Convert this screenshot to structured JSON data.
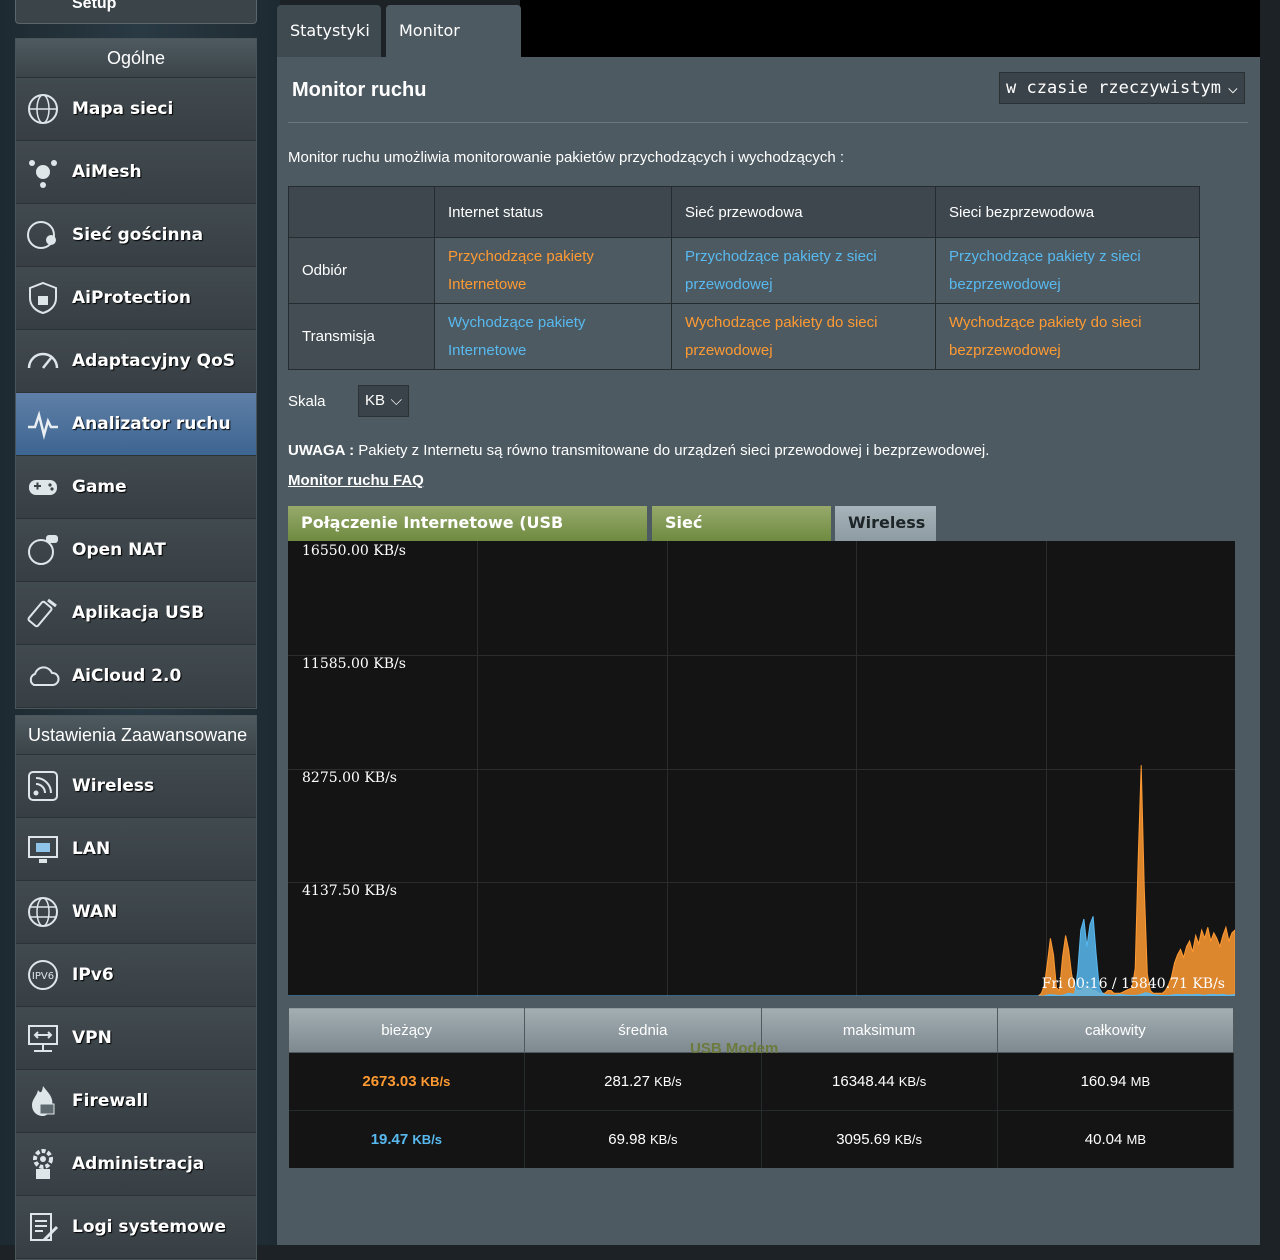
{
  "sidebar": {
    "top_stub_label": "Setup",
    "general": {
      "heading": "Ogólne",
      "items": [
        {
          "label": "Mapa sieci",
          "icon": "globe-network-icon"
        },
        {
          "label": "AiMesh",
          "icon": "aimesh-icon"
        },
        {
          "label": "Sieć gościnna",
          "icon": "guest-network-icon"
        },
        {
          "label": "AiProtection",
          "icon": "shield-lock-icon"
        },
        {
          "label": "Adaptacyjny QoS",
          "icon": "speedometer-icon"
        },
        {
          "label": "Analizator ruchu",
          "icon": "traffic-analyzer-icon"
        },
        {
          "label": "Game",
          "icon": "gamepad-icon"
        },
        {
          "label": "Open NAT",
          "icon": "open-nat-icon"
        },
        {
          "label": "Aplikacja USB",
          "icon": "usb-app-icon"
        },
        {
          "label": "AiCloud 2.0",
          "icon": "cloud-icon"
        }
      ]
    },
    "advanced": {
      "heading": "Ustawienia Zaawansowane",
      "items": [
        {
          "label": "Wireless",
          "icon": "wireless-icon"
        },
        {
          "label": "LAN",
          "icon": "lan-icon"
        },
        {
          "label": "WAN",
          "icon": "wan-globe-icon"
        },
        {
          "label": "IPv6",
          "icon": "ipv6-icon"
        },
        {
          "label": "VPN",
          "icon": "vpn-icon"
        },
        {
          "label": "Firewall",
          "icon": "firewall-icon"
        },
        {
          "label": "Administracja",
          "icon": "admin-gear-icon"
        },
        {
          "label": "Logi systemowe",
          "icon": "system-log-icon"
        }
      ]
    }
  },
  "tabs": {
    "stats": "Statystyki",
    "monitor": "Monitor ruchu"
  },
  "main": {
    "title": "Monitor ruchu",
    "mode_select": "w czasie rzeczywistym",
    "description": "Monitor ruchu umożliwia monitorowanie pakietów przychodzących i wychodzących :",
    "legend": {
      "headers": [
        "Internet status",
        "Sieć przewodowa",
        "Sieci bezprzewodowa"
      ],
      "rows": [
        {
          "label": "Odbiór",
          "cells": [
            "Przychodzące pakiety Internetowe",
            "Przychodzące pakiety z sieci przewodowej",
            "Przychodzące pakiety z sieci bezprzewodowej"
          ]
        },
        {
          "label": "Transmisja",
          "cells": [
            "Wychodzące pakiety Internetowe",
            "Wychodzące pakiety do sieci przewodowej",
            "Wychodzące pakiety do sieci bezprzewodowej"
          ]
        }
      ]
    },
    "scale_label": "Skala",
    "scale_value": "KB",
    "note_bold": "UWAGA :",
    "note_text": " Pakiety z Internetu są równo transmitowane do urządzeń sieci przewodowej i bezprzewodowej.",
    "faq_link": "Monitor ruchu FAQ",
    "graph_tabs": [
      "Połączenie Internetowe (USB Modem)",
      "Sieć przewodowa",
      "Wireless"
    ],
    "graph_overlay": "USB Modem",
    "colors": {
      "rx": "#ff9a32",
      "tx": "#58b9f0",
      "active_tab": "#7f9a4f"
    }
  },
  "chart_data": {
    "type": "area",
    "y_tick_labels": [
      "16550.00 KB/s",
      "11585.00 KB/s",
      "8275.00 KB/s",
      "4137.50 KB/s"
    ],
    "ylim": [
      0,
      16550
    ],
    "timestamp_label": "Fri 00:16 / 15840.71 KB/s",
    "series": [
      {
        "color": "#ff9a32",
        "values": [
          0,
          0,
          0,
          0,
          0,
          0,
          0,
          0,
          0,
          0,
          0,
          0,
          0,
          0,
          0,
          0,
          0,
          0,
          0,
          0,
          0,
          0,
          0,
          0,
          0,
          0,
          0,
          0,
          0,
          0,
          0,
          0,
          0,
          0,
          0,
          0,
          0,
          0,
          0,
          0,
          0,
          0,
          0,
          0,
          0,
          0,
          0,
          0,
          0,
          0,
          0,
          0,
          0,
          0,
          0,
          0,
          0,
          0,
          0,
          0,
          0,
          0,
          0,
          0,
          0,
          0,
          0,
          0,
          0,
          0,
          0,
          0,
          0,
          0,
          0,
          0,
          0,
          0,
          0,
          0,
          0,
          0,
          0,
          0,
          0,
          0,
          0,
          0,
          0,
          0,
          0,
          0,
          0,
          0,
          0,
          0,
          0,
          0,
          0,
          0,
          0,
          0,
          0,
          0,
          0,
          0,
          0,
          0,
          0,
          0,
          0,
          0,
          0,
          0,
          0,
          0,
          0,
          0,
          0,
          0,
          0,
          0,
          0,
          0,
          0,
          0,
          0,
          0,
          0,
          0,
          0,
          0,
          0,
          0,
          0,
          0,
          0,
          0,
          0,
          0,
          0,
          0,
          0,
          0,
          0,
          0,
          0,
          0,
          0,
          0,
          0,
          0,
          0,
          0,
          0,
          0,
          0,
          0,
          0,
          0,
          0,
          0,
          0,
          0,
          0,
          0,
          0,
          0,
          0,
          0,
          0,
          0,
          0,
          0,
          0,
          0,
          0,
          0,
          0,
          0,
          0,
          0,
          0,
          0,
          0,
          0,
          0,
          0,
          0,
          0,
          0,
          0,
          0,
          0,
          0,
          0,
          0,
          0,
          0,
          0,
          0,
          0,
          0,
          0,
          0,
          0,
          0,
          0,
          0,
          0,
          0,
          0,
          0,
          0,
          0,
          0,
          0,
          0,
          0,
          0,
          0,
          0,
          0,
          0,
          0,
          0,
          0,
          0,
          0,
          0,
          0,
          0,
          0,
          0,
          0,
          0,
          0,
          0,
          0,
          0,
          0,
          0,
          0,
          0,
          0,
          0,
          0,
          0,
          0,
          100,
          400,
          1200,
          2100,
          1500,
          300,
          200,
          1400,
          2200,
          1700,
          800,
          300,
          200,
          200,
          300,
          400,
          300,
          200,
          200,
          100,
          100,
          100,
          200,
          200,
          100,
          100,
          100,
          150,
          200,
          250,
          300,
          1000,
          5000,
          8400,
          4000,
          800,
          200,
          100,
          100,
          100,
          100,
          200,
          400,
          700,
          1200,
          1500,
          1700,
          1400,
          1800,
          2000,
          1600,
          2200,
          1900,
          2400,
          2100,
          2500,
          2000,
          2300,
          2100,
          1800,
          2200,
          2500,
          2000,
          2300,
          2400
        ]
      },
      {
        "color": "#58b9f0",
        "values": [
          0,
          0,
          0,
          0,
          0,
          0,
          0,
          0,
          0,
          0,
          0,
          0,
          0,
          0,
          0,
          0,
          0,
          0,
          0,
          0,
          0,
          0,
          0,
          0,
          0,
          0,
          0,
          0,
          0,
          0,
          0,
          0,
          0,
          0,
          0,
          0,
          0,
          0,
          0,
          0,
          0,
          0,
          0,
          0,
          0,
          0,
          0,
          0,
          0,
          0,
          0,
          0,
          0,
          0,
          0,
          0,
          0,
          0,
          0,
          0,
          0,
          0,
          0,
          0,
          0,
          0,
          0,
          0,
          0,
          0,
          0,
          0,
          0,
          0,
          0,
          0,
          0,
          0,
          0,
          0,
          0,
          0,
          0,
          0,
          0,
          0,
          0,
          0,
          0,
          0,
          0,
          0,
          0,
          0,
          0,
          0,
          0,
          0,
          0,
          0,
          0,
          0,
          0,
          0,
          0,
          0,
          0,
          0,
          0,
          0,
          0,
          0,
          0,
          0,
          0,
          0,
          0,
          0,
          0,
          0,
          0,
          0,
          0,
          0,
          0,
          0,
          0,
          0,
          0,
          0,
          0,
          0,
          0,
          0,
          0,
          0,
          0,
          0,
          0,
          0,
          0,
          0,
          0,
          0,
          0,
          0,
          0,
          0,
          0,
          0,
          0,
          0,
          0,
          0,
          0,
          0,
          0,
          0,
          0,
          0,
          0,
          0,
          0,
          0,
          0,
          0,
          0,
          0,
          0,
          0,
          0,
          0,
          0,
          0,
          0,
          0,
          0,
          0,
          0,
          0,
          0,
          0,
          0,
          0,
          0,
          0,
          0,
          0,
          0,
          0,
          0,
          0,
          0,
          0,
          0,
          0,
          0,
          0,
          0,
          0,
          0,
          0,
          0,
          0,
          0,
          0,
          0,
          0,
          0,
          0,
          0,
          0,
          0,
          0,
          0,
          0,
          0,
          0,
          0,
          0,
          0,
          0,
          0,
          0,
          0,
          0,
          0,
          0,
          0,
          0,
          0,
          0,
          0,
          0,
          0,
          0,
          0,
          0,
          0,
          0,
          0,
          0,
          0,
          0,
          0,
          0,
          30,
          50,
          40,
          30,
          20,
          30,
          50,
          100,
          80,
          60,
          900,
          2400,
          2800,
          1800,
          2600,
          2900,
          1500,
          300,
          100,
          50,
          40,
          30,
          30,
          40,
          50,
          40,
          30,
          30,
          20,
          30,
          40,
          80,
          120,
          100,
          60,
          40,
          30,
          20,
          20,
          20,
          30,
          40,
          60,
          50,
          40,
          60,
          50,
          40,
          50,
          60,
          40,
          30,
          40,
          50,
          60,
          40,
          50,
          60,
          40,
          30,
          40,
          50
        ]
      }
    ]
  },
  "stats": {
    "headers": [
      "bieżący",
      "średnia",
      "maksimum",
      "całkowity"
    ],
    "rows": [
      {
        "current": "2673.03",
        "current_unit": "KB/s",
        "avg": "281.27",
        "avg_unit": "KB/s",
        "max": "16348.44",
        "max_unit": "KB/s",
        "total": "160.94",
        "total_unit": "MB"
      },
      {
        "current": "19.47",
        "current_unit": "KB/s",
        "avg": "69.98",
        "avg_unit": "KB/s",
        "max": "3095.69",
        "max_unit": "KB/s",
        "total": "40.04",
        "total_unit": "MB"
      }
    ]
  }
}
